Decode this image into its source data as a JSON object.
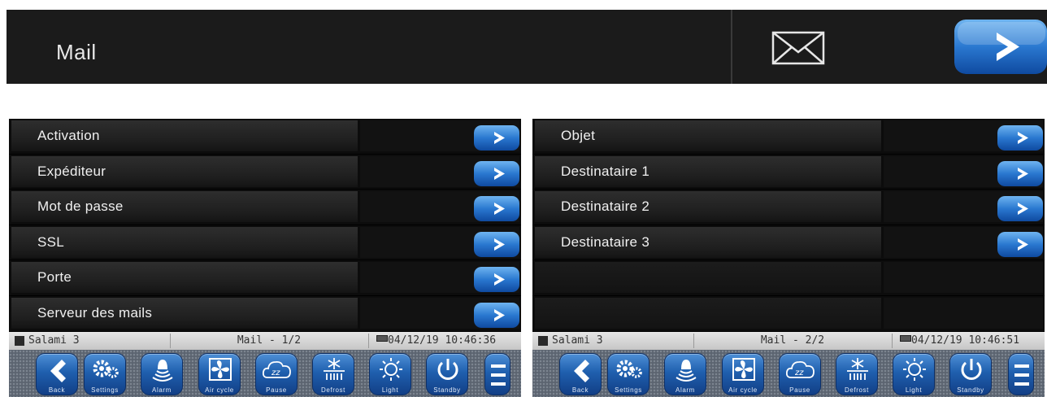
{
  "header": {
    "title": "Mail"
  },
  "panels": [
    {
      "rows": [
        {
          "label": "Activation"
        },
        {
          "label": "Expéditeur"
        },
        {
          "label": "Mot de passe"
        },
        {
          "label": "SSL"
        },
        {
          "label": "Porte"
        },
        {
          "label": "Serveur des mails"
        }
      ],
      "status": {
        "name": "Salami 3",
        "page": "Mail - 1/2",
        "datetime": "04/12/19 10:46:36"
      }
    },
    {
      "rows": [
        {
          "label": "Objet"
        },
        {
          "label": "Destinataire 1"
        },
        {
          "label": "Destinataire 2"
        },
        {
          "label": "Destinataire 3"
        },
        {
          "label": ""
        },
        {
          "label": ""
        }
      ],
      "status": {
        "name": "Salami 3",
        "page": "Mail - 2/2",
        "datetime": "04/12/19 10:46:51"
      }
    }
  ],
  "toolbar": {
    "buttons": [
      {
        "label": "Back",
        "icon": "back-icon"
      },
      {
        "label": "Settings",
        "icon": "gears-icon"
      },
      {
        "label": "Alarm",
        "icon": "bell-icon"
      },
      {
        "label": "Air cycle",
        "icon": "fan-icon"
      },
      {
        "label": "Pause",
        "icon": "pause-cloud-icon"
      },
      {
        "label": "Defrost",
        "icon": "defrost-icon"
      },
      {
        "label": "Light",
        "icon": "sun-icon"
      },
      {
        "label": "Standby",
        "icon": "power-icon"
      },
      {
        "label": "",
        "icon": "menu-icon"
      }
    ]
  },
  "colors": {
    "button_blue": "#1f5fae",
    "background_dark": "#0c0c0c",
    "header_dark": "#1b1b1b",
    "status_grey": "#d6d6d6"
  }
}
